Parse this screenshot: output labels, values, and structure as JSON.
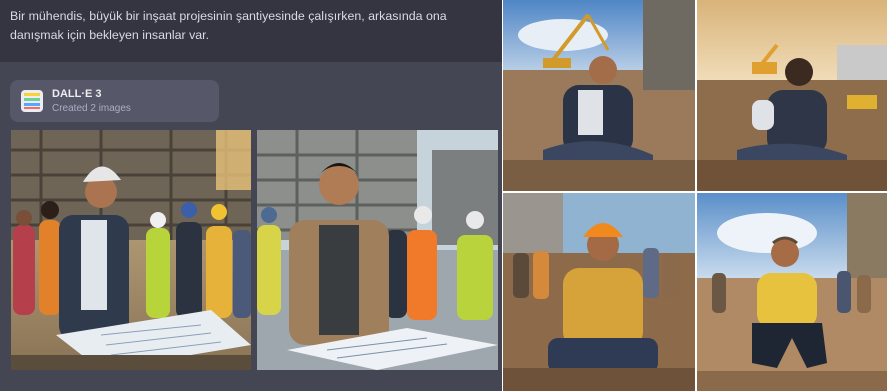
{
  "chat": {
    "user_prompt": "Bir mühendis, büyük bir inşaat projesinin şantiyesinde çalışırken, arkasında ona danışmak için bekleyen insanlar var.",
    "tool": {
      "name": "DALL·E 3",
      "status": "Created 2 images",
      "icon": "dalle-logo-icon"
    },
    "images": [
      {
        "name": "generated-image-1",
        "subject": "engineer reviewing blueprints with workers behind"
      },
      {
        "name": "generated-image-2",
        "subject": "engineer drawing on blueprints at construction site"
      }
    ]
  },
  "grid": {
    "tiles": [
      {
        "name": "grid-image-top-left"
      },
      {
        "name": "grid-image-top-right"
      },
      {
        "name": "grid-image-bottom-left"
      },
      {
        "name": "grid-image-bottom-right"
      }
    ]
  },
  "colors": {
    "user_bg": "#343541",
    "assistant_bg": "#444654",
    "pill_bg": "#565869",
    "text": "#d9dae2",
    "logo_bars": [
      "#f6d138",
      "#6fcf97",
      "#58a6ff",
      "#ef6f6c"
    ]
  }
}
